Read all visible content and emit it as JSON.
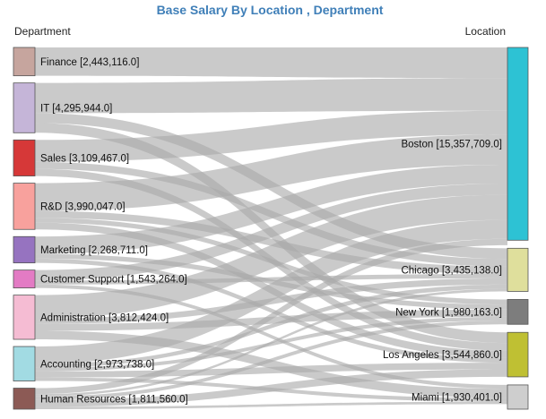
{
  "chart_data": {
    "type": "sankey",
    "title": "Base Salary By Location , Department",
    "left_header": "Department",
    "right_header": "Location",
    "sources": [
      {
        "name": "Finance",
        "value": 2443116.0,
        "label": "Finance [2,443,116.0]",
        "color": "#c6a59e"
      },
      {
        "name": "IT",
        "value": 4295944.0,
        "label": "IT [4,295,944.0]",
        "color": "#c5b5d8"
      },
      {
        "name": "Sales",
        "value": 3109467.0,
        "label": "Sales [3,109,467.0]",
        "color": "#d63838"
      },
      {
        "name": "R&D",
        "value": 3990047.0,
        "label": "R&D [3,990,047.0]",
        "color": "#f8a19d"
      },
      {
        "name": "Marketing",
        "value": 2268711.0,
        "label": "Marketing [2,268,711.0]",
        "color": "#9673c0"
      },
      {
        "name": "Customer Support",
        "value": 1543264.0,
        "label": "Customer Support [1,543,264.0]",
        "color": "#e37bc4"
      },
      {
        "name": "Administration",
        "value": 3812424.0,
        "label": "Administration [3,812,424.0]",
        "color": "#f5bcd3"
      },
      {
        "name": "Accounting",
        "value": 2973738.0,
        "label": "Accounting [2,973,738.0]",
        "color": "#a2dbe3"
      },
      {
        "name": "Human Resources",
        "value": 1811560.0,
        "label": "Human Resources [1,811,560.0]",
        "color": "#8c5a55"
      }
    ],
    "targets": [
      {
        "name": "Boston",
        "value": 15357709.0,
        "label": "Boston [15,357,709.0]",
        "color": "#2dc2d4"
      },
      {
        "name": "Chicago",
        "value": 3435138.0,
        "label": "Chicago [3,435,138.0]",
        "color": "#dfdf9c"
      },
      {
        "name": "New York",
        "value": 1980163.0,
        "label": "New York [1,980,163.0]",
        "color": "#7d7d7d"
      },
      {
        "name": "Los Angeles",
        "value": 3544860.0,
        "label": "Los Angeles [3,544,860.0]",
        "color": "#bfc033"
      },
      {
        "name": "Miami",
        "value": 1930401.0,
        "label": "Miami [1,930,401.0]",
        "color": "#cecece"
      }
    ],
    "links": [
      {
        "source": "Finance",
        "target": "Boston",
        "value": 2443116.0
      },
      {
        "source": "IT",
        "target": "Boston",
        "value": 2600000.0
      },
      {
        "source": "IT",
        "target": "Chicago",
        "value": 850000.0
      },
      {
        "source": "IT",
        "target": "Los Angeles",
        "value": 845944.0
      },
      {
        "source": "Sales",
        "target": "Boston",
        "value": 1900000.0
      },
      {
        "source": "Sales",
        "target": "Chicago",
        "value": 600000.0
      },
      {
        "source": "Sales",
        "target": "Los Angeles",
        "value": 609467.0
      },
      {
        "source": "R&D",
        "target": "Boston",
        "value": 2400000.0
      },
      {
        "source": "R&D",
        "target": "Chicago",
        "value": 600000.0
      },
      {
        "source": "R&D",
        "target": "New York",
        "value": 400000.0
      },
      {
        "source": "R&D",
        "target": "Los Angeles",
        "value": 590047.0
      },
      {
        "source": "Marketing",
        "target": "Boston",
        "value": 1500000.0
      },
      {
        "source": "Marketing",
        "target": "New York",
        "value": 400000.0
      },
      {
        "source": "Marketing",
        "target": "Los Angeles",
        "value": 368711.0
      },
      {
        "source": "Customer Support",
        "target": "Boston",
        "value": 900000.0
      },
      {
        "source": "Customer Support",
        "target": "Chicago",
        "value": 343264.0
      },
      {
        "source": "Customer Support",
        "target": "Miami",
        "value": 300000.0
      },
      {
        "source": "Administration",
        "target": "Boston",
        "value": 2000000.0
      },
      {
        "source": "Administration",
        "target": "Chicago",
        "value": 500000.0
      },
      {
        "source": "Administration",
        "target": "New York",
        "value": 580163.0
      },
      {
        "source": "Administration",
        "target": "Miami",
        "value": 732261.0
      },
      {
        "source": "Accounting",
        "target": "Boston",
        "value": 1500000.0
      },
      {
        "source": "Accounting",
        "target": "Chicago",
        "value": 341874.0
      },
      {
        "source": "Accounting",
        "target": "New York",
        "value": 300000.0
      },
      {
        "source": "Accounting",
        "target": "Los Angeles",
        "value": 531864.0
      },
      {
        "source": "Accounting",
        "target": "Miami",
        "value": 300000.0
      },
      {
        "source": "Human Resources",
        "target": "Boston",
        "value": 514593.0
      },
      {
        "source": "Human Resources",
        "target": "Chicago",
        "value": 200000.0
      },
      {
        "source": "Human Resources",
        "target": "New York",
        "value": 300000.0
      },
      {
        "source": "Human Resources",
        "target": "Los Angeles",
        "value": 598827.0
      },
      {
        "source": "Human Resources",
        "target": "Miami",
        "value": 198140.0
      }
    ],
    "link_color": "#a9a9a9"
  }
}
